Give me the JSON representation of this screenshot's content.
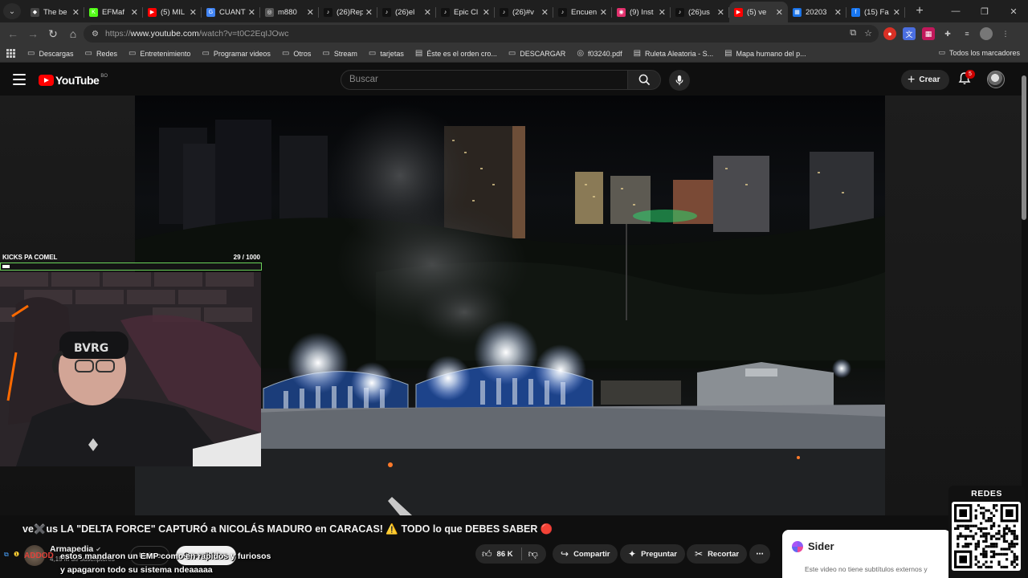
{
  "browser": {
    "tabs": [
      {
        "title": "The be",
        "color": "#444",
        "glyph": "◆"
      },
      {
        "title": "EFMaf",
        "color": "#53fc18",
        "glyph": "K"
      },
      {
        "title": "(5) MIL",
        "color": "#ff0000",
        "glyph": "▶"
      },
      {
        "title": "CUANT",
        "color": "#4285f4",
        "glyph": "G"
      },
      {
        "title": "m880",
        "color": "#555",
        "glyph": "◎"
      },
      {
        "title": "(26)Rep",
        "color": "#111",
        "glyph": "♪"
      },
      {
        "title": "(26)el",
        "color": "#111",
        "glyph": "♪"
      },
      {
        "title": "Epic Cl",
        "color": "#111",
        "glyph": "♪"
      },
      {
        "title": "(26)#v",
        "color": "#111",
        "glyph": "♪"
      },
      {
        "title": "Encuen",
        "color": "#111",
        "glyph": "♪"
      },
      {
        "title": "(9) Inst",
        "color": "#e1306c",
        "glyph": "◉"
      },
      {
        "title": "(26)us",
        "color": "#111",
        "glyph": "♪"
      },
      {
        "title": "(5) ve",
        "color": "#ff0000",
        "glyph": "▶",
        "active": true
      },
      {
        "title": "20203",
        "color": "#1a73e8",
        "glyph": "▦"
      },
      {
        "title": "(15) Fa",
        "color": "#1877f2",
        "glyph": "f"
      }
    ],
    "url_prefix": "https://",
    "url_host": "www.youtube.com",
    "url_path": "/watch?v=t0C2EqIJOwc",
    "bookmarks": [
      {
        "label": "Descargas",
        "icon": "folder-icon"
      },
      {
        "label": "Redes",
        "icon": "folder-icon"
      },
      {
        "label": "Entretenimiento",
        "icon": "folder-icon"
      },
      {
        "label": "Programar videos",
        "icon": "folder-icon"
      },
      {
        "label": "Otros",
        "icon": "folder-icon"
      },
      {
        "label": "Stream",
        "icon": "folder-icon"
      },
      {
        "label": "tarjetas",
        "icon": "folder-icon"
      },
      {
        "label": "Éste es el orden cro...",
        "icon": "page-icon"
      },
      {
        "label": "DESCARGAR",
        "icon": "folder-icon"
      },
      {
        "label": "f03240.pdf",
        "icon": "globe-icon"
      },
      {
        "label": "Ruleta Aleatoria - S...",
        "icon": "page-icon"
      },
      {
        "label": "Mapa humano del p...",
        "icon": "page-icon"
      }
    ],
    "all_bookmarks": "Todos los marcadores"
  },
  "youtube": {
    "logo": "YouTube",
    "country": "BO",
    "search_placeholder": "Buscar",
    "create_label": "Crear",
    "notifications": "5"
  },
  "overlay": {
    "goal_label": "KICKS PA COMEL",
    "goal_count": "29  / 1000",
    "goal_progress": 0.029
  },
  "video": {
    "title": "ve✖️us LA \"DELTA FORCE\" CAPTURÓ a NICOLÁS MADURO en CARACAS! ⚠️ TODO lo que DEBES SABER 🔴",
    "channel": "Armapedia",
    "subscribers": "4,15 M de suscriptores",
    "join_label": "Unirse",
    "subscribe_label": "Suscribirme",
    "likes": "86 K",
    "share_label": "Compartir",
    "ask_label": "Preguntar",
    "clip_label": "Recortar"
  },
  "chat": {
    "user": "ADDOD",
    "line1": "estos mandaron un EMP como en rapidos y furiosos",
    "line2": "y apagaron todo su sistema ndeaaaaa"
  },
  "sider": {
    "name": "Sider",
    "message": "Este video no tiene subtítulos externos y"
  },
  "qr": {
    "label": "REDES"
  }
}
